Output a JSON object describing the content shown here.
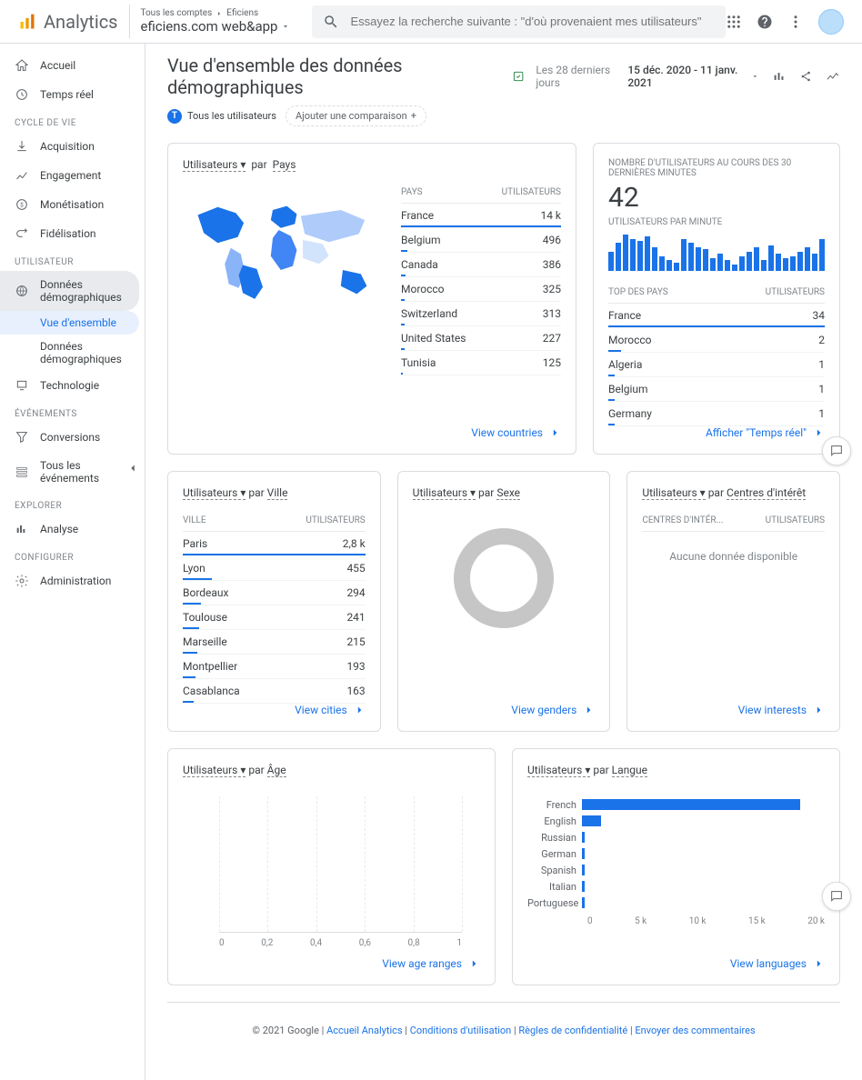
{
  "header": {
    "product": "Analytics",
    "breadcrumb1": "Tous les comptes",
    "breadcrumb2": "Eficiens",
    "property": "eficiens.com web&app",
    "search_placeholder": "Essayez la recherche suivante : \"d'où provenaient mes utilisateurs\""
  },
  "sidebar": {
    "items_top": [
      {
        "label": "Accueil"
      },
      {
        "label": "Temps réel"
      }
    ],
    "section_lifecycle": "CYCLE DE VIE",
    "items_lifecycle": [
      {
        "label": "Acquisition"
      },
      {
        "label": "Engagement"
      },
      {
        "label": "Monétisation"
      },
      {
        "label": "Fidélisation"
      }
    ],
    "section_user": "UTILISATEUR",
    "items_user": [
      {
        "label": "Données démographiques",
        "sub": [
          {
            "label": "Vue d'ensemble",
            "active": true
          },
          {
            "label": "Données démographiques"
          }
        ]
      },
      {
        "label": "Technologie"
      }
    ],
    "section_events": "ÉVÉNEMENTS",
    "items_events": [
      {
        "label": "Conversions"
      },
      {
        "label": "Tous les événements"
      }
    ],
    "section_explore": "EXPLORER",
    "items_explore": [
      {
        "label": "Analyse"
      }
    ],
    "section_config": "CONFIGURER",
    "items_config": [
      {
        "label": "Administration"
      }
    ]
  },
  "page": {
    "title": "Vue d'ensemble des données démographiques",
    "period_label": "Les 28 derniers jours",
    "date_range": "15 déc. 2020 - 11 janv. 2021",
    "chip_all_users": "Tous les utilisateurs",
    "add_comparison": "Ajouter une comparaison"
  },
  "country_card": {
    "metric_label": "Utilisateurs",
    "by_label": "par",
    "dimension": "Pays",
    "table_header_dim": "PAYS",
    "table_header_val": "UTILISATEURS",
    "rows": [
      {
        "label": "France",
        "value": "14 k",
        "bar": 100
      },
      {
        "label": "Belgium",
        "value": "496",
        "bar": 4
      },
      {
        "label": "Canada",
        "value": "386",
        "bar": 3
      },
      {
        "label": "Morocco",
        "value": "325",
        "bar": 2
      },
      {
        "label": "Switzerland",
        "value": "313",
        "bar": 2
      },
      {
        "label": "United States",
        "value": "227",
        "bar": 2
      },
      {
        "label": "Tunisia",
        "value": "125",
        "bar": 1
      }
    ],
    "link": "View countries"
  },
  "realtime_card": {
    "title": "NOMBRE D'UTILISATEURS AU COURS DES 30 DERNIÈRES MINUTES",
    "value": "42",
    "per_minute": "UTILISATEURS PAR MINUTE",
    "spark": [
      18,
      26,
      34,
      30,
      28,
      32,
      22,
      14,
      10,
      8,
      30,
      26,
      22,
      20,
      12,
      16,
      10,
      6,
      14,
      18,
      22,
      10,
      24,
      16,
      12,
      14,
      18,
      22,
      16,
      30
    ],
    "top_header_dim": "TOP DES PAYS",
    "top_header_val": "UTILISATEURS",
    "rows": [
      {
        "label": "France",
        "value": "34",
        "bar": 100
      },
      {
        "label": "Morocco",
        "value": "2",
        "bar": 6
      },
      {
        "label": "Algeria",
        "value": "1",
        "bar": 3
      },
      {
        "label": "Belgium",
        "value": "1",
        "bar": 3
      },
      {
        "label": "Germany",
        "value": "1",
        "bar": 3
      }
    ],
    "link": "Afficher \"Temps réel\""
  },
  "city_card": {
    "metric_label": "Utilisateurs",
    "by_label": "par",
    "dimension": "Ville",
    "table_header_dim": "VILLE",
    "table_header_val": "UTILISATEURS",
    "rows": [
      {
        "label": "Paris",
        "value": "2,8 k",
        "bar": 100
      },
      {
        "label": "Lyon",
        "value": "455",
        "bar": 16
      },
      {
        "label": "Bordeaux",
        "value": "294",
        "bar": 10
      },
      {
        "label": "Toulouse",
        "value": "241",
        "bar": 9
      },
      {
        "label": "Marseille",
        "value": "215",
        "bar": 8
      },
      {
        "label": "Montpellier",
        "value": "193",
        "bar": 7
      },
      {
        "label": "Casablanca",
        "value": "163",
        "bar": 6
      }
    ],
    "link": "View cities"
  },
  "gender_card": {
    "metric_label": "Utilisateurs",
    "by_label": "par",
    "dimension": "Sexe",
    "link": "View genders"
  },
  "interest_card": {
    "metric_label": "Utilisateurs",
    "by_label": "par",
    "dimension": "Centres d'intérêt",
    "table_header_dim": "CENTRES D'INTÉR...",
    "table_header_val": "UTILISATEURS",
    "nodata": "Aucune donnée disponible",
    "link": "View interests"
  },
  "age_card": {
    "metric_label": "Utilisateurs",
    "by_label": "par",
    "dimension": "Âge",
    "ticks": [
      "0",
      "0,2",
      "0,4",
      "0,6",
      "0,8",
      "1"
    ],
    "link": "View age ranges"
  },
  "language_card": {
    "metric_label": "Utilisateurs",
    "by_label": "par",
    "dimension": "Langue",
    "rows": [
      {
        "label": "French",
        "bar": 90
      },
      {
        "label": "English",
        "bar": 8
      },
      {
        "label": "Russian",
        "bar": 1
      },
      {
        "label": "German",
        "bar": 1
      },
      {
        "label": "Spanish",
        "bar": 1
      },
      {
        "label": "Italian",
        "bar": 1
      },
      {
        "label": "Portuguese",
        "bar": 1
      }
    ],
    "ticks": [
      "0",
      "5 k",
      "10 k",
      "15 k",
      "20 k"
    ],
    "link": "View languages"
  },
  "chart_data": [
    {
      "type": "bar",
      "title": "Utilisateurs par Pays",
      "categories": [
        "France",
        "Belgium",
        "Canada",
        "Morocco",
        "Switzerland",
        "United States",
        "Tunisia"
      ],
      "values": [
        14000,
        496,
        386,
        325,
        313,
        227,
        125
      ],
      "xlabel": "",
      "ylabel": "Utilisateurs"
    },
    {
      "type": "bar",
      "title": "Utilisateurs par minute (30 dernières minutes)",
      "categories": [],
      "values": [
        18,
        26,
        34,
        30,
        28,
        32,
        22,
        14,
        10,
        8,
        30,
        26,
        22,
        20,
        12,
        16,
        10,
        6,
        14,
        18,
        22,
        10,
        24,
        16,
        12,
        14,
        18,
        22,
        16,
        30
      ],
      "xlabel": "minute",
      "ylabel": "utilisateurs"
    },
    {
      "type": "bar",
      "title": "Top des pays (temps réel)",
      "categories": [
        "France",
        "Morocco",
        "Algeria",
        "Belgium",
        "Germany"
      ],
      "values": [
        34,
        2,
        1,
        1,
        1
      ]
    },
    {
      "type": "bar",
      "title": "Utilisateurs par Ville",
      "categories": [
        "Paris",
        "Lyon",
        "Bordeaux",
        "Toulouse",
        "Marseille",
        "Montpellier",
        "Casablanca"
      ],
      "values": [
        2800,
        455,
        294,
        241,
        215,
        193,
        163
      ]
    },
    {
      "type": "pie",
      "title": "Utilisateurs par Sexe",
      "categories": [],
      "values": []
    },
    {
      "type": "bar",
      "title": "Utilisateurs par Âge",
      "categories": [],
      "values": [],
      "xlim": [
        0,
        1
      ]
    },
    {
      "type": "bar",
      "title": "Utilisateurs par Langue",
      "categories": [
        "French",
        "English",
        "Russian",
        "German",
        "Spanish",
        "Italian",
        "Portuguese"
      ],
      "values": [
        18000,
        1600,
        200,
        180,
        160,
        140,
        120
      ],
      "xlim": [
        0,
        20000
      ]
    }
  ],
  "footer": {
    "copyright": "© 2021 Google",
    "links": [
      "Accueil Analytics",
      "Conditions d'utilisation",
      "Règles de confidentialité",
      "Envoyer des commentaires"
    ]
  }
}
